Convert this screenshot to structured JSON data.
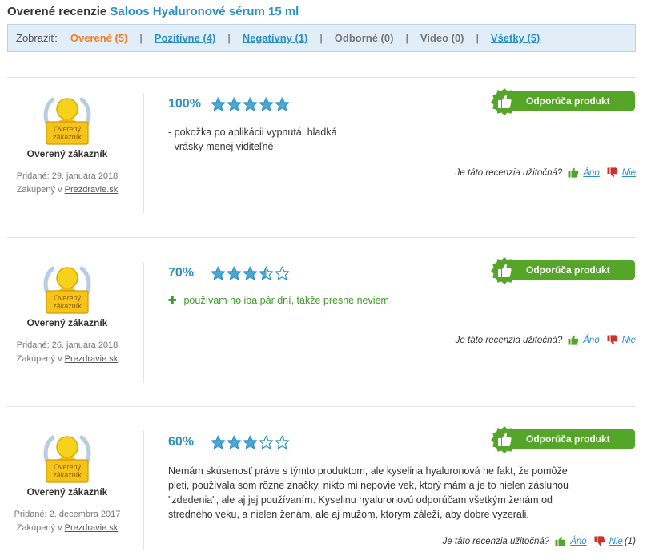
{
  "header": {
    "title_prefix": "Overené recenzie",
    "product_name": "Saloos Hyaluronové sérum 15 ml"
  },
  "filters": {
    "label": "Zobraziť:",
    "items": [
      {
        "label": "Overené (5)",
        "state": "active"
      },
      {
        "label": "Pozitívne (4)",
        "state": "link"
      },
      {
        "label": "Negatívny (1)",
        "state": "link"
      },
      {
        "label": "Odborné (0)",
        "state": "muted"
      },
      {
        "label": "Video (0)",
        "state": "muted"
      },
      {
        "label": "Všetky (5)",
        "state": "link"
      }
    ]
  },
  "badge_text": "Overený zákazník",
  "recommend_label": "Odporúča produkt",
  "useful": {
    "question": "Je táto recenzia užitočná?",
    "yes": "Áno",
    "no": "Nie"
  },
  "reviews": [
    {
      "author": "Overený zákazník",
      "added": "Pridané: 29. januára 2018",
      "bought_prefix": "Zakúpený v",
      "shop": "Prezdravie.sk",
      "percent": "100%",
      "rating": 5,
      "lines": [
        "- pokožka po aplikácii vypnutá, hladká",
        "- vrásky menej viditeľné"
      ]
    },
    {
      "author": "Overený zákazník",
      "added": "Pridané: 26. januára 2018",
      "bought_prefix": "Zakúpený v",
      "shop": "Prezdravie.sk",
      "percent": "70%",
      "rating": 3.5,
      "pro": "používam ho iba pár dní, takže presne neviem"
    },
    {
      "author": "Overený zákazník",
      "added": "Pridané: 2. decembra 2017",
      "bought_prefix": "Zakúpený v",
      "shop": "Prezdravie.sk",
      "percent": "60%",
      "rating": 3,
      "lines": [
        "Nemám skúsenosť práve s týmto produktom, ale kyselina hyaluronová he fakt, že pomôže",
        "pleti, používala som rôzne značky, nikto mi nepovie vek, ktorý mám a je to nielen zásluhou",
        "\"zdedenia\", ale aj jej používaním. Kyselinu hyaluronovú odporúčam všetkým ženám od",
        "stredného veku, a nielen ženám, ale aj mužom, ktorým záleží, aby dobre vyzerali."
      ],
      "no_count": "(1)"
    }
  ],
  "colors": {
    "accent_blue": "#2b8fc4",
    "active_orange": "#f47b20",
    "recommend_green": "#54a528",
    "star_fill": "#4aa8d8"
  }
}
